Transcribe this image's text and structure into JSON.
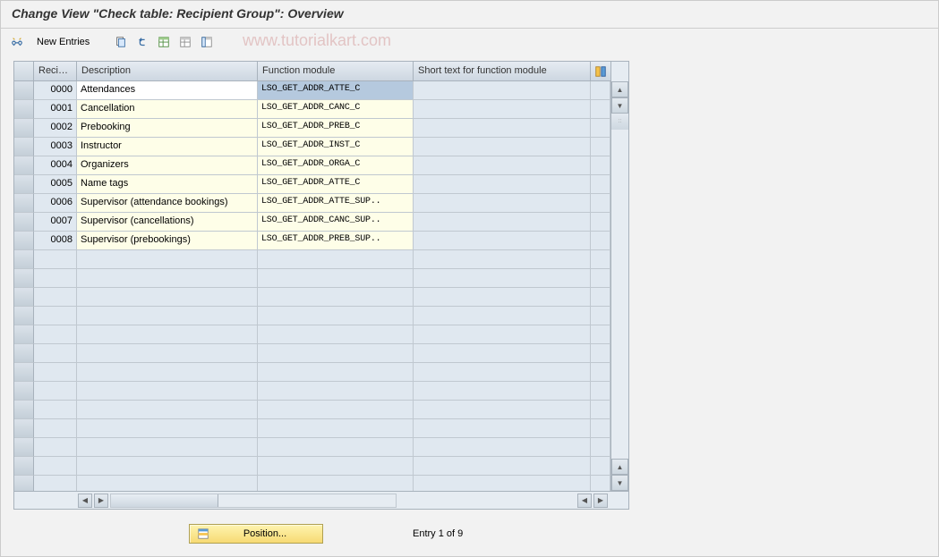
{
  "title": "Change View \"Check table: Recipient Group\": Overview",
  "toolbar": {
    "new_entries": "New Entries"
  },
  "watermark": "www.tutorialkart.com",
  "table": {
    "columns": {
      "recip": "Recip...",
      "description": "Description",
      "function_module": "Function module",
      "short_text": "Short text for function module"
    },
    "rows": [
      {
        "code": "0000",
        "desc": "Attendances",
        "fm": "LSO_GET_ADDR_ATTE_C",
        "short": ""
      },
      {
        "code": "0001",
        "desc": "Cancellation",
        "fm": "LSO_GET_ADDR_CANC_C",
        "short": ""
      },
      {
        "code": "0002",
        "desc": "Prebooking",
        "fm": "LSO_GET_ADDR_PREB_C",
        "short": ""
      },
      {
        "code": "0003",
        "desc": "Instructor",
        "fm": "LSO_GET_ADDR_INST_C",
        "short": ""
      },
      {
        "code": "0004",
        "desc": "Organizers",
        "fm": "LSO_GET_ADDR_ORGA_C",
        "short": ""
      },
      {
        "code": "0005",
        "desc": "Name tags",
        "fm": "LSO_GET_ADDR_ATTE_C",
        "short": ""
      },
      {
        "code": "0006",
        "desc": "Supervisor (attendance bookings)",
        "fm": "LSO_GET_ADDR_ATTE_SUP..",
        "short": ""
      },
      {
        "code": "0007",
        "desc": "Supervisor (cancellations)",
        "fm": "LSO_GET_ADDR_CANC_SUP..",
        "short": ""
      },
      {
        "code": "0008",
        "desc": "Supervisor (prebookings)",
        "fm": "LSO_GET_ADDR_PREB_SUP..",
        "short": ""
      }
    ]
  },
  "footer": {
    "position_btn": "Position...",
    "entry_text": "Entry 1 of 9"
  }
}
